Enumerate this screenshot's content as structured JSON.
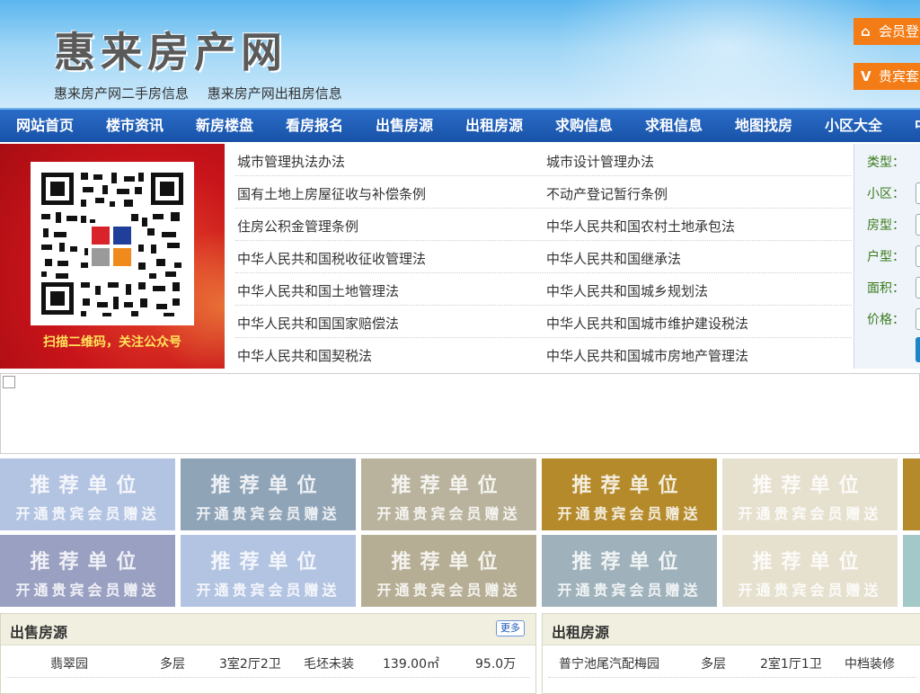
{
  "header": {
    "title": "惠来房产网",
    "links": [
      "惠来房产网二手房信息",
      "惠来房产网出租房信息"
    ],
    "login_label": "会员登",
    "vip_label": "贵宾套",
    "vip_badge": "V",
    "colors": {
      "button": "#f47c16"
    }
  },
  "nav": {
    "items": [
      "网站首页",
      "楼市资讯",
      "新房楼盘",
      "看房报名",
      "出售房源",
      "出租房源",
      "求购信息",
      "求租信息",
      "地图找房",
      "小区大全",
      "中"
    ]
  },
  "qr": {
    "caption": "扫描二维码，关注公众号"
  },
  "laws": {
    "left": [
      "城市管理执法办法",
      "国有土地上房屋征收与补偿条例",
      "住房公积金管理条例",
      "中华人民共和国税收征收管理法",
      "中华人民共和国土地管理法",
      "中华人民共和国国家赔偿法",
      "中华人民共和国契税法"
    ],
    "right": [
      "城市设计管理办法",
      "不动产登记暂行条例",
      "中华人民共和国农村土地承包法",
      "中华人民共和国继承法",
      "中华人民共和国城乡规划法",
      "中华人民共和国城市维护建设税法",
      "中华人民共和国城市房地产管理法"
    ]
  },
  "search": {
    "fields": [
      "类型：",
      "小区：",
      "房型：",
      "户型：",
      "面积：",
      "价格："
    ]
  },
  "ads": {
    "line1": "推荐单位",
    "line2": "开通贵宾会员赠送",
    "colors": [
      "#b3c4e2",
      "#90a4b8",
      "#b9b39d",
      "#b58a2b",
      "#e6e0cf",
      "#b58a2b",
      "#9aa0c2",
      "#b3c4e2",
      "#b6ae94",
      "#9fb2bb",
      "#e6e0cf",
      "#a3c8c8"
    ]
  },
  "sale": {
    "title": "出售房源",
    "more": "更多",
    "rows": [
      [
        "翡翠园",
        "多层",
        "3室2厅2卫",
        "毛坯未装",
        "139.00㎡",
        "95.0万"
      ]
    ]
  },
  "rent": {
    "title": "出租房源",
    "rows": [
      [
        "普宁池尾汽配梅园",
        "多层",
        "2室1厅1卫",
        "中档装修"
      ]
    ]
  }
}
